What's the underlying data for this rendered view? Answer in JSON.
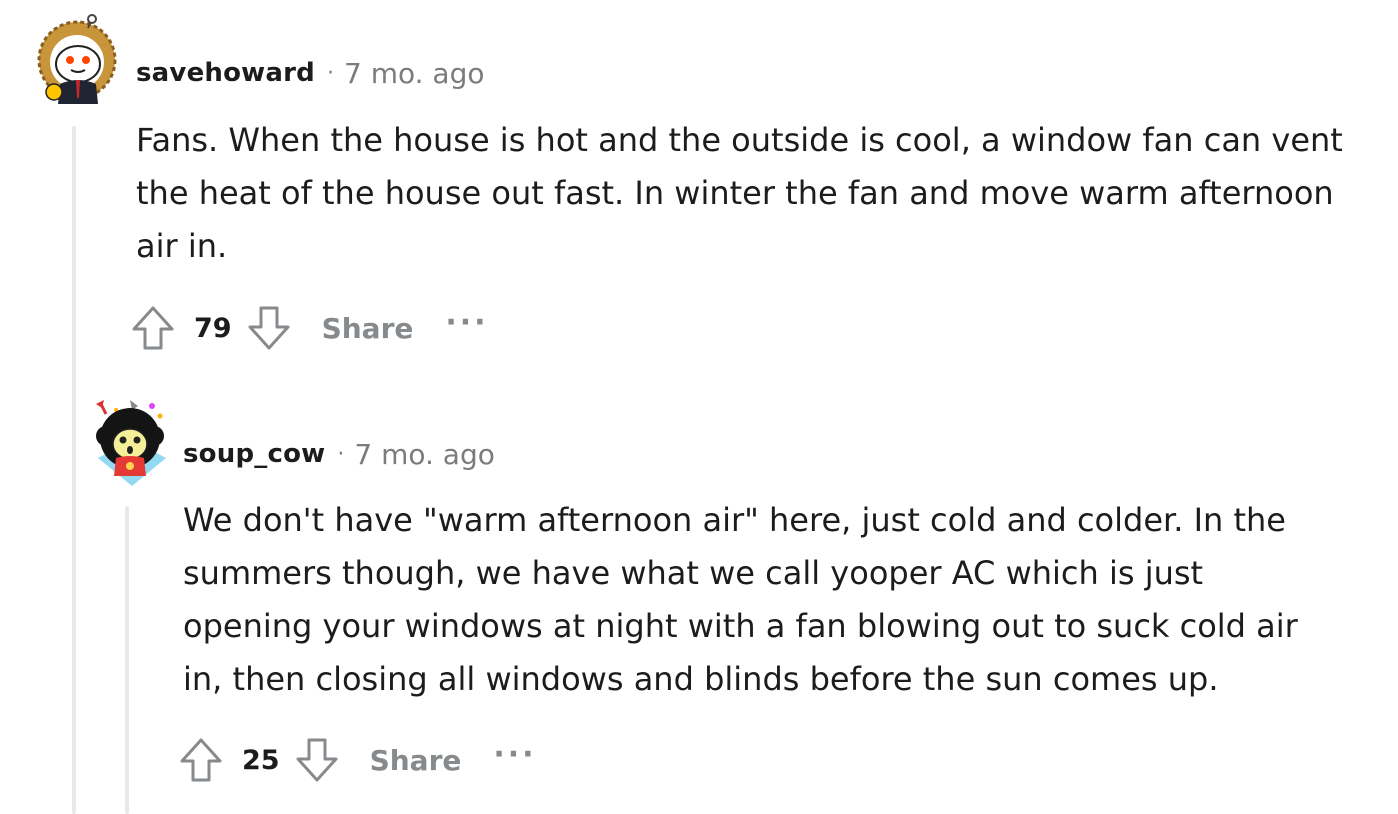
{
  "comments": [
    {
      "username": "savehoward",
      "separator": "·",
      "time": "7 mo. ago",
      "lines": [
        "Fans. When the house is hot and the outside is cool, a window fan can vent",
        "the heat of the house out fast. In winter the fan and move warm afternoon",
        "air in."
      ],
      "score": "79",
      "share_label": "Share",
      "more_label": "···",
      "avatar_icon": "reddit-snoo-avatar-icon"
    },
    {
      "username": "soup_cow",
      "separator": "·",
      "time": "7 mo. ago",
      "lines": [
        "We don't have \"warm afternoon air\" here, just cold and colder. In the",
        "summers though, we have what we call yooper AC which is just",
        "opening your windows at night with a fan blowing out to suck cold air",
        "in, then closing all windows and blinds before the sun comes up."
      ],
      "score": "25",
      "share_label": "Share",
      "more_label": "···",
      "avatar_icon": "reddit-snoo-avatar-icon"
    }
  ],
  "colors": {
    "text": "#1c1c1c",
    "meta": "#7c7c7c",
    "action": "#878a8c",
    "thread_line": "#e9e9e9"
  }
}
